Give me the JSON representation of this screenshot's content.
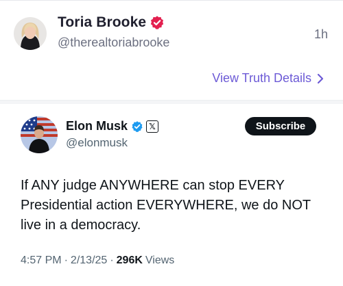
{
  "truth_post": {
    "author_name": "Toria Brooke",
    "author_handle": "@therealtoriabrooke",
    "time_ago": "1h",
    "view_details_label": "View Truth Details"
  },
  "quoted_post": {
    "author_name": "Elon Musk",
    "author_handle": "@elonmusk",
    "subscribe_label": "Subscribe",
    "badge_glyph": "𝕏",
    "text": "If ANY judge ANYWHERE can stop EVERY Presidential action EVERYWHERE, we do NOT live in a democracy.",
    "time": "4:57 PM",
    "date": "2/13/25",
    "views_count": "296K",
    "views_label": "Views"
  },
  "colors": {
    "truth_verified": "#e3204f",
    "x_verified": "#1d9bf0",
    "link_purple": "#6c5ad6"
  },
  "icons": [
    "verified-badge-icon",
    "x-logo-icon",
    "chevron-right-icon"
  ]
}
